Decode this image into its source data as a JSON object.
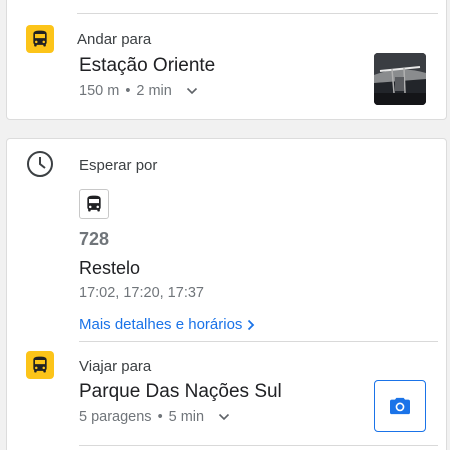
{
  "walk_step": {
    "action_label": "Andar para",
    "destination": "Estação Oriente",
    "distance": "150 m",
    "separator": "•",
    "duration": "2 min",
    "icon": "bus-icon",
    "thumbnail": "station-photo"
  },
  "wait_step": {
    "action_label": "Esperar por",
    "icon": "clock-icon",
    "route_icon": "bus-icon",
    "route_number": "728",
    "route_destination": "Restelo",
    "departure_times": "17:02, 17:20, 17:37",
    "details_link": "Mais detalhes e horários"
  },
  "ride_step": {
    "action_label": "Viajar para",
    "destination": "Parque Das Nações Sul",
    "stops": "5 paragens",
    "separator": "•",
    "duration": "5 min",
    "icon": "bus-icon",
    "camera_button_icon": "camera-icon"
  },
  "colors": {
    "transit_yellow": "#fcc419",
    "link_blue": "#1a73e8",
    "secondary_text": "#70757a"
  }
}
